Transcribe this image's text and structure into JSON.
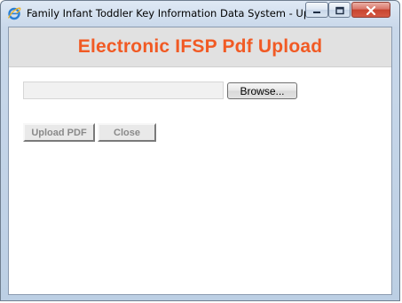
{
  "window": {
    "title": "Family Infant Toddler Key Information Data System - Up...",
    "controls": {
      "minimize_icon": "minimize-icon",
      "maximize_icon": "maximize-icon",
      "close_icon": "close-icon"
    }
  },
  "header": {
    "title": "Electronic IFSP Pdf Upload",
    "title_color": "#f15a24"
  },
  "upload": {
    "file_path_value": "",
    "browse_label": "Browse..."
  },
  "actions": {
    "upload_label": "Upload PDF",
    "close_label": "Close"
  },
  "colors": {
    "accent": "#f15a24",
    "header_bg": "#e1e1e1",
    "close_button": "#c7442f"
  }
}
